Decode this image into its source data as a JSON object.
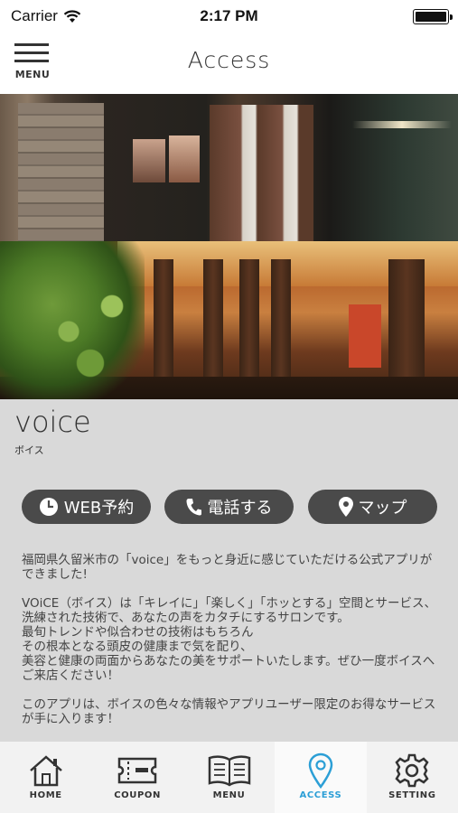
{
  "status_bar": {
    "carrier": "Carrier",
    "time": "2:17 PM",
    "wifi_icon": "wifi-icon",
    "battery_level": 1.0
  },
  "header": {
    "menu_label": "MENU",
    "title": "Access",
    "menu_icon": "hamburger-menu-icon"
  },
  "shop": {
    "name": "voice",
    "kana": "ボイス"
  },
  "actions": [
    {
      "label": "WEB予約",
      "icon": "clock-icon"
    },
    {
      "label": "電話する",
      "icon": "phone-icon"
    },
    {
      "label": "マップ",
      "icon": "map-pin-icon"
    }
  ],
  "description": [
    "福岡県久留米市の「voice」をもっと身近に感じていただける公式アプリができました!",
    "VOiCE（ボイス）は「キレイに」「楽しく」「ホッとする」空間とサービス、\n洗練された技術で、あなたの声をカタチにするサロンです。\n最旬トレンドや似合わせの技術はもちろん\nその根本となる頭皮の健康まで気を配り、\n美容と健康の両面からあなたの美をサポートいたします。ぜひ一度ボイスへご来店ください！",
    "このアプリは、ボイスの色々な情報やアプリユーザー限定のお得なサービスが手に入ります！"
  ],
  "tabs": [
    {
      "label": "HOME",
      "icon": "home-icon",
      "active": false
    },
    {
      "label": "COUPON",
      "icon": "coupon-ticket-icon",
      "active": false
    },
    {
      "label": "MENU",
      "icon": "book-icon",
      "active": false
    },
    {
      "label": "ACCESS",
      "icon": "map-pin-icon",
      "active": true
    },
    {
      "label": "SETTING",
      "icon": "gear-icon",
      "active": false
    }
  ],
  "colors": {
    "accent": "#2c9fd6",
    "button_bg": "#4a4a4a",
    "background": "#d9d9d9"
  }
}
